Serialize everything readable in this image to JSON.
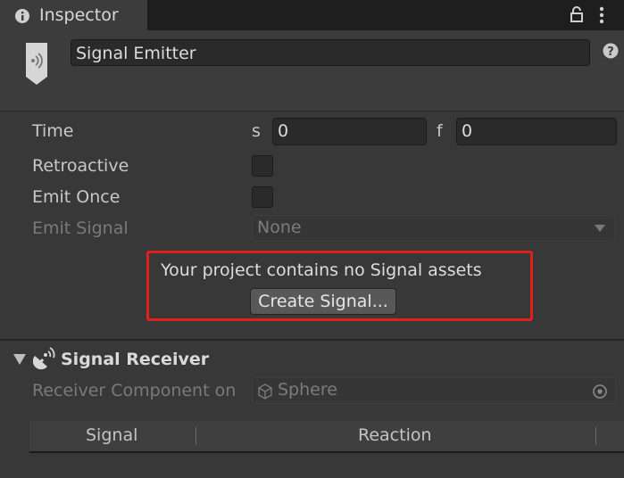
{
  "tab": {
    "title": "Inspector"
  },
  "header": {
    "object_name": "Signal Emitter"
  },
  "emitter": {
    "time_label": "Time",
    "seconds_prefix": "s",
    "seconds_value": "0",
    "frames_prefix": "f",
    "frames_value": "0",
    "retroactive_label": "Retroactive",
    "emit_once_label": "Emit Once",
    "emit_signal_label": "Emit Signal",
    "emit_signal_value": "None",
    "no_assets_message": "Your project contains no Signal assets",
    "create_signal_button": "Create Signal..."
  },
  "receiver": {
    "title": "Signal Receiver",
    "component_label": "Receiver Component on",
    "component_value": "Sphere",
    "columns": [
      "Signal",
      "Reaction"
    ]
  },
  "icons": [
    "info-icon",
    "lock-icon",
    "kebab-menu-icon",
    "signal-emitter-icon",
    "help-icon",
    "dropdown-arrow-icon",
    "foldout-arrow-icon",
    "signal-receiver-icon",
    "cube-icon",
    "object-picker-icon"
  ]
}
